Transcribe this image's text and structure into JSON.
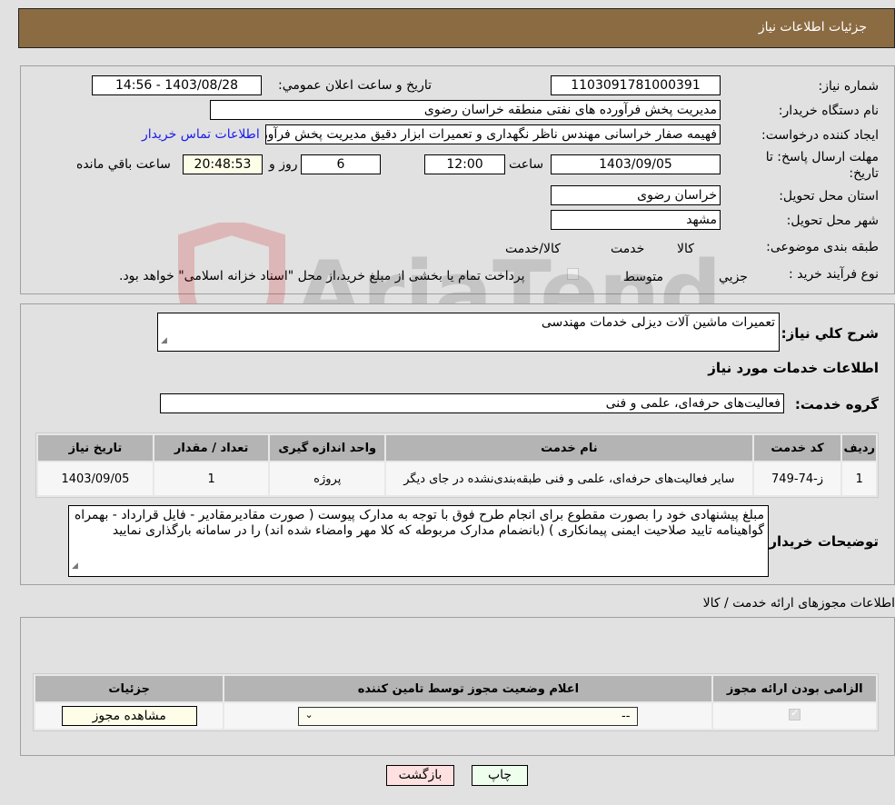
{
  "header": {
    "title": "جزئیات اطلاعات نیاز"
  },
  "details": {
    "need_number_label": "شماره نیاز:",
    "need_number": "1103091781000391",
    "announce_label": "تاریخ و ساعت اعلان عمومي:",
    "announce_value": "1403/08/28 - 14:56",
    "buyer_org_label": "نام دستگاه خریدار:",
    "buyer_org": "مدیریت پخش فرآورده های نفتی منطقه خراسان رضوی",
    "creator_label": "ایجاد کننده درخواست:",
    "creator": "فهیمه صفار خراسانی مهندس ناظر نگهداری و تعمیرات ابزار دقیق مدیریت پخش فرآورده های نفتی",
    "contact_link": "اطلاعات تماس خریدار",
    "deadline_label": "مهلت ارسال پاسخ: تا تاریخ:",
    "deadline_date": "1403/09/05",
    "time_label": "ساعت",
    "deadline_time": "12:00",
    "days_value": "6",
    "days_label": "روز و",
    "remaining_time": "20:48:53",
    "remaining_label": "ساعت باقي مانده",
    "province_label": "استان محل تحویل:",
    "province": "خراسان رضوی",
    "city_label": "شهر محل تحویل:",
    "city": "مشهد",
    "category_label": "طبقه بندی موضوعی:",
    "category_options": [
      {
        "label": "کالا",
        "checked": false
      },
      {
        "label": "خدمت",
        "checked": true
      },
      {
        "label": "کالا/خدمت",
        "checked": false
      }
    ],
    "process_label": "نوع فرآیند خرید :",
    "process_options": [
      {
        "label": "جزيي",
        "checked": false
      },
      {
        "label": "متوسط",
        "checked": true
      }
    ],
    "treasury_note": "پرداخت تمام یا بخشی از مبلغ خرید،از محل \"اسناد خزانه اسلامی\" خواهد بود."
  },
  "summary": {
    "general_desc_label": "شرح كلي نياز:",
    "general_desc": "تعمیرات ماشین آلات دیزلی خدمات مهندسی",
    "services_heading": "اطلاعات خدمات مورد نیاز",
    "service_group_label": "گروه خدمت:",
    "service_group": "فعالیت‌های حرفه‌ای، علمی و فنی",
    "table": {
      "headers": [
        "ردیف",
        "کد خدمت",
        "نام خدمت",
        "واحد اندازه گیری",
        "تعداد / مقدار",
        "تاریخ نیاز"
      ],
      "rows": [
        [
          "1",
          "ز-74-749",
          "سایر فعالیت‌های حرفه‌ای، علمی و فنی طبقه‌بندی‌نشده در جای دیگر",
          "پروژه",
          "1",
          "1403/09/05"
        ]
      ]
    },
    "buyer_notes_label": "توضیحات خریدار:",
    "buyer_notes": "مبلغ پیشنهادی خود را بصورت مقطوع برای انجام طرح فوق با توجه به مدارک پیوست ( صورت مقادیرمقادیر - فایل قرارداد - بهمراه گواهینامه تایید صلاحیت ایمنی پیمانکاری ) (بانضمام مدارک مربوطه که کلا مهر وامضاء شده اند) را در سامانه بارگذاری نمایید"
  },
  "licenses": {
    "heading": "اطلاعات مجوزهای ارائه خدمت / کالا",
    "headers": [
      "الزامی بودن ارائه مجوز",
      "اعلام وضعیت مجوز توسط تامین کننده",
      "جزئیات"
    ],
    "row": {
      "required": true,
      "status_value": "--",
      "details_button": "مشاهده مجوز"
    }
  },
  "footer": {
    "print_button": "چاپ",
    "back_button": "بازگشت"
  },
  "colors": {
    "header_bg": "#8b6b42",
    "print_bg": "#eeffee",
    "back_bg": "#ffe0e0",
    "link": "#1a1aee"
  },
  "watermark": "AriaTender.neT"
}
